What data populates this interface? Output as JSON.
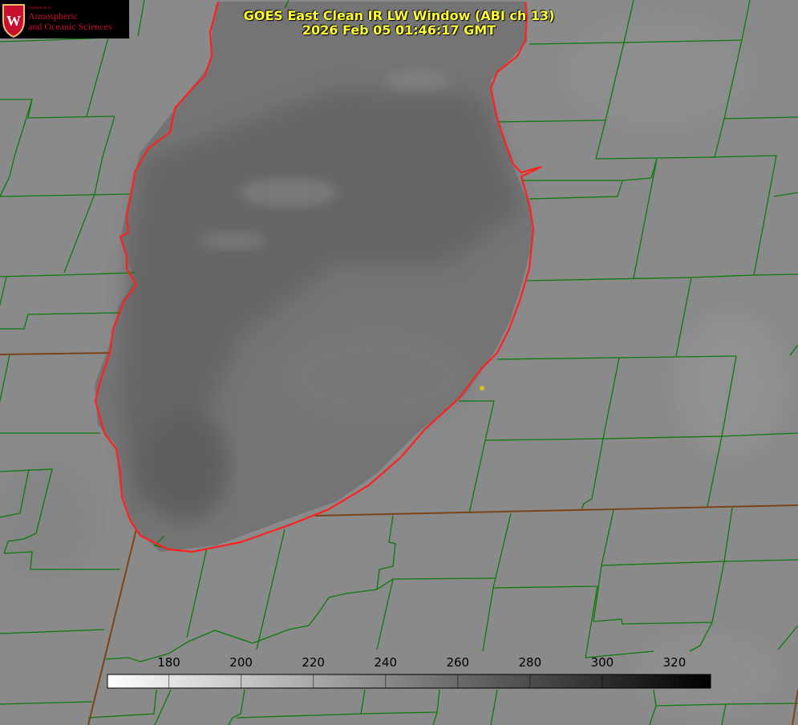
{
  "title": {
    "line1": "GOES East Clean IR LW Window (ABI ch 13)",
    "line2": "2026 Feb 05 01:46:17 GMT"
  },
  "logo": {
    "dept": "Department of",
    "line1": "Atmospheric",
    "line2": "and Oceanic Sciences",
    "shield_letter": "W",
    "color": "#c8102e"
  },
  "colorbar": {
    "min": 163,
    "max": 330,
    "ticks": [
      180,
      200,
      220,
      240,
      260,
      280,
      300,
      320
    ],
    "gradient_start": "#ffffff",
    "gradient_end": "#000000"
  },
  "colors": {
    "boundaries": "#0b7a0b",
    "shoreline": "#ff2020",
    "state_line": "#7a4418",
    "marker": "#d8c020",
    "land": "#8a8a8a",
    "lake": "#6b6b6b",
    "title": "#ffff33"
  }
}
